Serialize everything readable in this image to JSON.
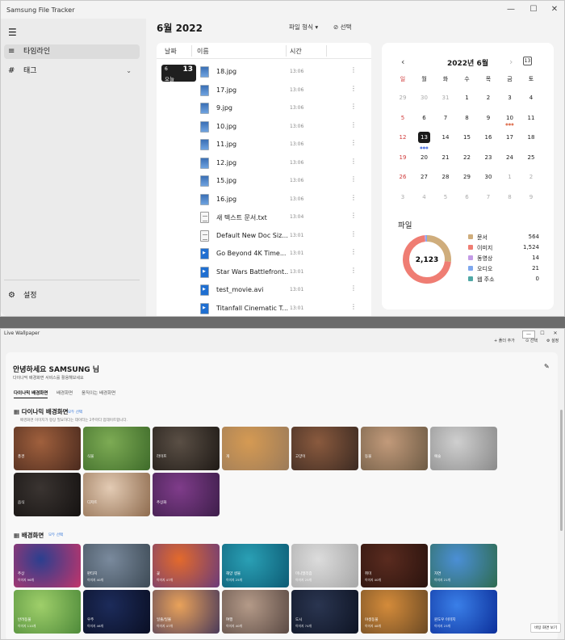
{
  "tracker": {
    "title": "Samsung File Tracker",
    "win_buttons": [
      "—",
      "☐",
      "✕"
    ],
    "nav": [
      {
        "icon": "☰"
      },
      {
        "label": "타임라인",
        "icon": "≡"
      },
      {
        "label": "태그",
        "icon": "#",
        "chev": "⌄"
      }
    ],
    "settings": {
      "label": "설정",
      "icon": "⚙"
    },
    "month_title": "6월 2022",
    "file_format": "파일 형식 ▾",
    "select_label": "선택",
    "columns": {
      "date": "날짜",
      "name": "이름",
      "time": "시간"
    },
    "date_badge": {
      "month": "6",
      "day": "13",
      "label": "오늘"
    },
    "files": [
      {
        "name": "18.jpg",
        "time": "13:06",
        "type": "img"
      },
      {
        "name": "17.jpg",
        "time": "13:06",
        "type": "img"
      },
      {
        "name": "9.jpg",
        "time": "13:06",
        "type": "img"
      },
      {
        "name": "10.jpg",
        "time": "13:06",
        "type": "img"
      },
      {
        "name": "11.jpg",
        "time": "13:06",
        "type": "img"
      },
      {
        "name": "12.jpg",
        "time": "13:06",
        "type": "img"
      },
      {
        "name": "15.jpg",
        "time": "13:06",
        "type": "img"
      },
      {
        "name": "16.jpg",
        "time": "13:06",
        "type": "img"
      },
      {
        "name": "새 텍스트 문서.txt",
        "time": "13:04",
        "type": "doc"
      },
      {
        "name": "Default New Doc Siz...",
        "time": "13:01",
        "type": "doc"
      },
      {
        "name": "Go Beyond  4K Time...",
        "time": "13:01",
        "type": "vid"
      },
      {
        "name": "Star Wars Battlefront...",
        "time": "13:01",
        "type": "vid"
      },
      {
        "name": "test_movie.avi",
        "time": "13:01",
        "type": "vid"
      },
      {
        "name": "Titanfall  Cinematic T...",
        "time": "13:01",
        "type": "vid"
      }
    ],
    "more": "⋮",
    "calendar": {
      "title": "2022년 6월",
      "today_badge": "13",
      "prev": "‹",
      "next": "›",
      "weekdays": [
        "일",
        "월",
        "화",
        "수",
        "목",
        "금",
        "토"
      ],
      "weeks": [
        [
          "29",
          "30",
          "31",
          "1",
          "2",
          "3",
          "4"
        ],
        [
          "5",
          "6",
          "7",
          "8",
          "9",
          "10",
          "11"
        ],
        [
          "12",
          "13",
          "14",
          "15",
          "16",
          "17",
          "18"
        ],
        [
          "19",
          "20",
          "21",
          "22",
          "23",
          "24",
          "25"
        ],
        [
          "26",
          "27",
          "28",
          "29",
          "30",
          "1",
          "2"
        ],
        [
          "3",
          "4",
          "5",
          "6",
          "7",
          "8",
          "9"
        ]
      ],
      "dots": "●●●"
    },
    "pie": {
      "title": "파일",
      "total": "2,123",
      "legend": [
        {
          "name": "문서",
          "value": "564",
          "color": "#cfad7c"
        },
        {
          "name": "이미지",
          "value": "1,524",
          "color": "#ef7d73"
        },
        {
          "name": "동영상",
          "value": "14",
          "color": "#c39be6"
        },
        {
          "name": "오디오",
          "value": "21",
          "color": "#7ea7ee"
        },
        {
          "name": "웹 주소",
          "value": "0",
          "color": "#4fa8a5"
        }
      ]
    }
  },
  "wallpaper": {
    "title": "Live Wallpaper",
    "win_buttons": [
      "—",
      "☐",
      "✕"
    ],
    "toolbar": [
      {
        "icon": "+",
        "label": "폴더 추가"
      },
      {
        "icon": "⊙",
        "label": "선택"
      },
      {
        "icon": "⚙",
        "label": "설정"
      }
    ],
    "greeting": "안녕하세요  SAMSUNG  님",
    "greeting_sub": "다이나믹 배경화면 서비스를 활용해보세요",
    "edit_icon": "✎",
    "tabs": [
      "다이나믹 배경화면",
      "배경화면",
      "움직이는 배경화면"
    ],
    "dynamic": {
      "title": "다이나믹 배경화면",
      "action": "모두 선택",
      "desc": "배경화면 이미지가 항상 필요하다는 데이터는 2주마다 업데이트합니다.",
      "items": [
        {
          "label": "풍경",
          "c": "#a0603d,#4a2a1e"
        },
        {
          "label": "식물",
          "c": "#7dab54,#3e6b2a"
        },
        {
          "label": "라이프",
          "c": "#5a4f45,#1f1a16"
        },
        {
          "label": "개",
          "c": "#d59a53,#9b7b5a"
        },
        {
          "label": "고양이",
          "c": "#8a5a3e,#3b2a22"
        },
        {
          "label": "동물",
          "c": "#c29a7a,#6d5b45"
        },
        {
          "label": "예술",
          "c": "#cfcfcf,#8a8a8a"
        },
        {
          "label": "음식",
          "c": "#3a3431,#151211"
        },
        {
          "label": "디저트",
          "c": "#e3cbb4,#8e6b4e"
        },
        {
          "label": "추상화",
          "c": "#7f3c8a,#3d1e4a"
        }
      ]
    },
    "static": {
      "title": "배경화면",
      "action": "모두 선택",
      "items": [
        {
          "label": "추상",
          "count": "이미지 96개",
          "c": "#2b3f8f,#c2356b"
        },
        {
          "label": "판타지",
          "count": "이미지 40개",
          "c": "#7a8a9d,#3d4a55"
        },
        {
          "label": "꽃",
          "count": "이미지 47개",
          "c": "#e36a2c,#6a3b7a"
        },
        {
          "label": "해양 생물",
          "count": "이미지 25개",
          "c": "#2aa0b5,#0c5b74"
        },
        {
          "label": "미니멀리즘",
          "count": "이미지 25개",
          "c": "#dcdcdc,#a7a7a7"
        },
        {
          "label": "취미",
          "count": "이미지 40개",
          "c": "#5a2b1f,#2a130e"
        },
        {
          "label": "자연",
          "count": "이미지 21개",
          "c": "#4b8fd6,#2e6b4e"
        },
        {
          "label": "반려동물",
          "count": "이미지 110개",
          "c": "#9fcf6a,#4e8a3a"
        },
        {
          "label": "우주",
          "count": "이미지 46개",
          "c": "#1c2b5a,#0a0f24"
        },
        {
          "label": "일출/일몰",
          "count": "이미지 47개",
          "c": "#e9a25a,#4a3a5a"
        },
        {
          "label": "여행",
          "count": "이미지 40개",
          "c": "#b49a88,#5b4a44"
        },
        {
          "label": "도시",
          "count": "이미지 74개",
          "c": "#2a3550,#0e1424"
        },
        {
          "label": "야생동물",
          "count": "이미지 48개",
          "c": "#d48b3a,#6b4a25"
        },
        {
          "label": "윈도우 이미지",
          "count": "이미지 23개",
          "c": "#3a7fe8,#0c2f9a"
        }
      ]
    },
    "tooltip": "바탕 화면 보기"
  }
}
